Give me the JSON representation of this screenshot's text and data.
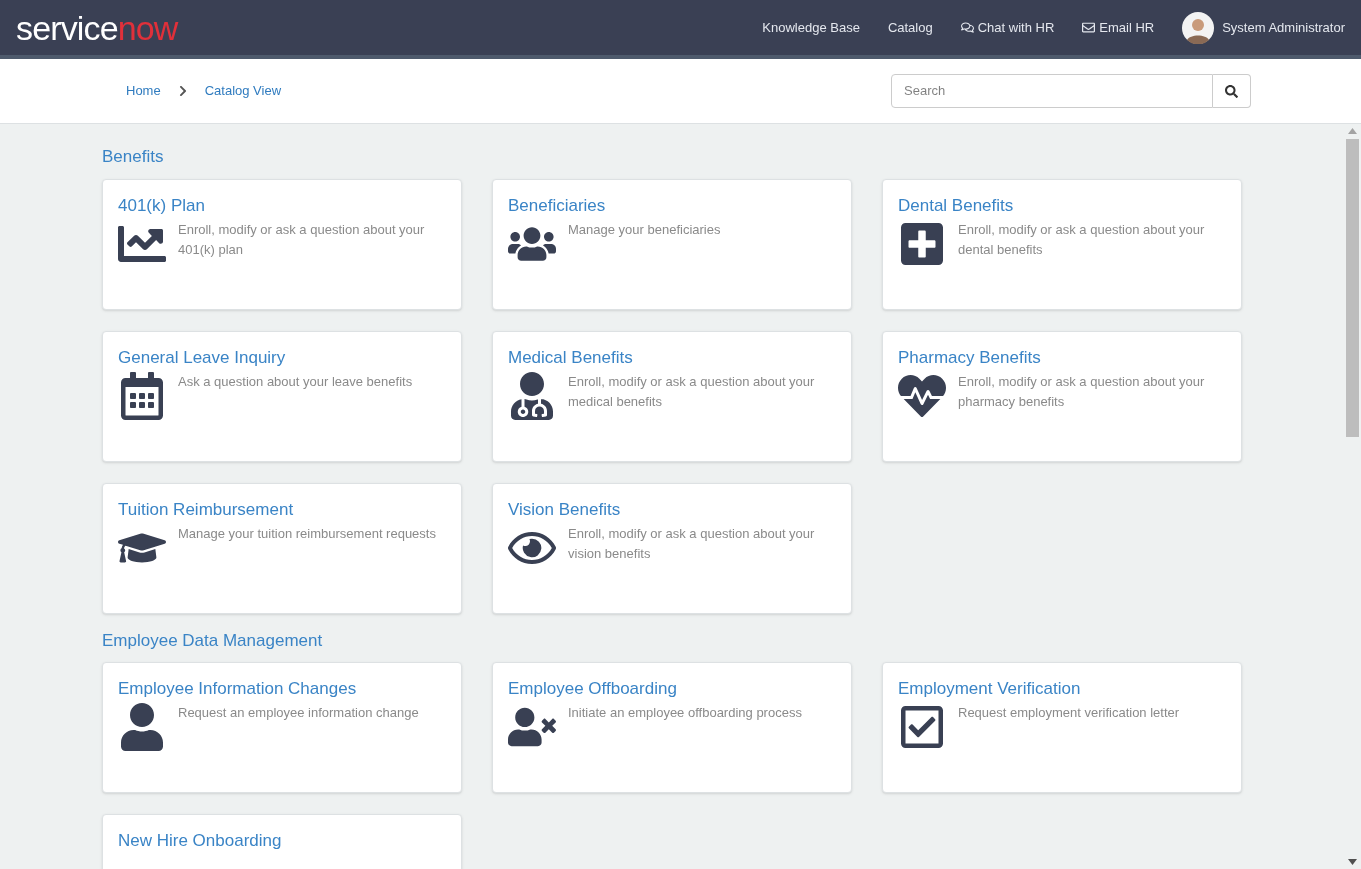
{
  "header": {
    "logo": {
      "first": "service",
      "accent": "now"
    },
    "nav": [
      "Knowledge Base",
      "Catalog",
      "Chat with HR",
      "Email HR"
    ],
    "user": "System Administrator"
  },
  "breadcrumbs": [
    "Home",
    "Catalog View"
  ],
  "search": {
    "placeholder": "Search"
  },
  "sections": [
    {
      "title": "Benefits",
      "items": [
        {
          "title": "401(k) Plan",
          "description": "Enroll, modify or ask a question about your 401(k) plan"
        },
        {
          "title": "Beneficiaries",
          "description": "Manage your beneficiaries"
        },
        {
          "title": "Dental Benefits",
          "description": "Enroll, modify or ask a question about your dental benefits"
        },
        {
          "title": "General Leave Inquiry",
          "description": "Ask a question about your leave benefits"
        },
        {
          "title": "Medical Benefits",
          "description": "Enroll, modify or ask a question about your medical benefits"
        },
        {
          "title": "Pharmacy Benefits",
          "description": "Enroll, modify or ask a question about your pharmacy benefits"
        },
        {
          "title": "Tuition Reimbursement",
          "description": "Manage your tuition reimbursement requests"
        },
        {
          "title": "Vision Benefits",
          "description": "Enroll, modify or ask a question about your vision benefits"
        }
      ]
    },
    {
      "title": "Employee Data Management",
      "items": [
        {
          "title": "Employee Information Changes",
          "description": "Request an employee information change"
        },
        {
          "title": "Employee Offboarding",
          "description": "Initiate an employee offboarding process"
        },
        {
          "title": "Employment Verification",
          "description": "Request employment verification letter"
        },
        {
          "title": "New Hire Onboarding"
        }
      ]
    }
  ]
}
